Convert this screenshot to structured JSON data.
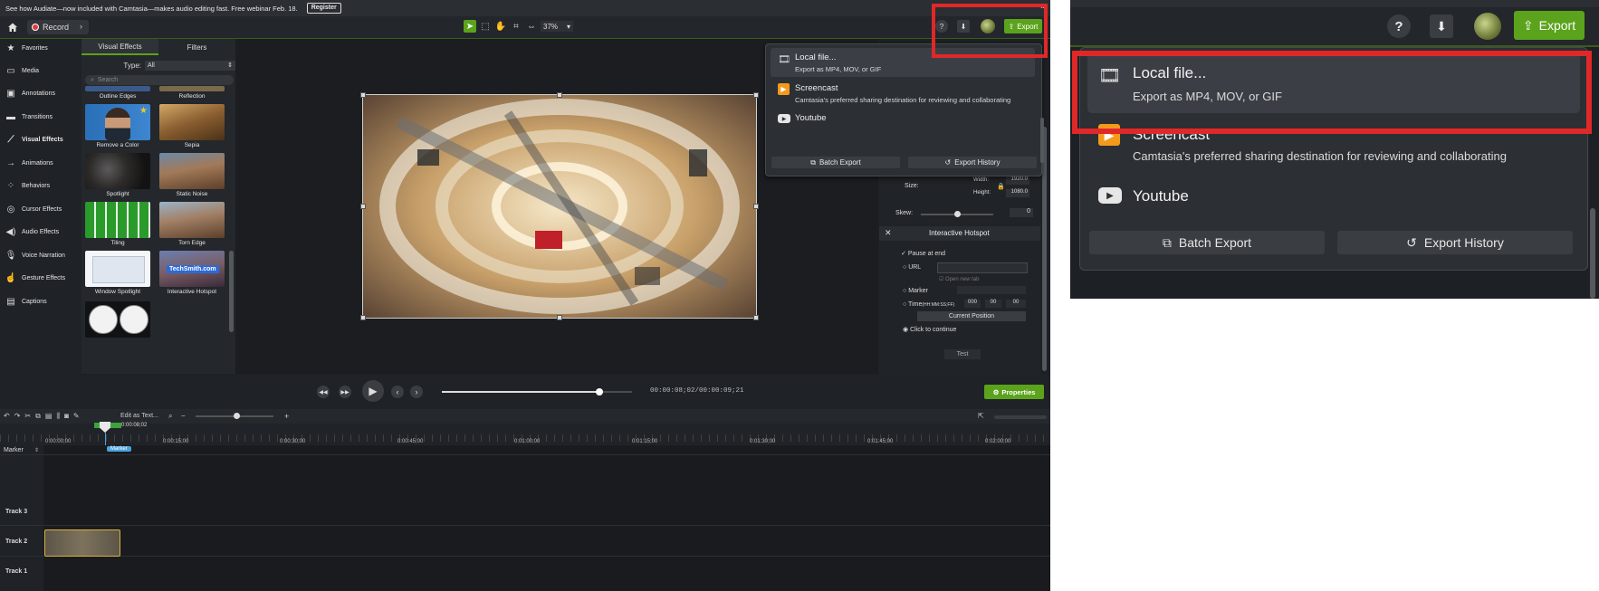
{
  "banner": {
    "text": "See how Audiate—now included with Camtasia—makes audio editing fast. Free webinar Feb. 18.",
    "register": "Register"
  },
  "topbar": {
    "record": "Record",
    "zoom": "37%",
    "export": "Export"
  },
  "sidebar": {
    "items": [
      {
        "label": "Favorites",
        "icon": "star-icon"
      },
      {
        "label": "Media",
        "icon": "media-icon"
      },
      {
        "label": "Annotations",
        "icon": "annotation-icon"
      },
      {
        "label": "Transitions",
        "icon": "transition-icon"
      },
      {
        "label": "Visual Effects",
        "icon": "wand-icon"
      },
      {
        "label": "Animations",
        "icon": "animation-icon"
      },
      {
        "label": "Behaviors",
        "icon": "behavior-icon"
      },
      {
        "label": "Cursor Effects",
        "icon": "cursor-icon"
      },
      {
        "label": "Audio Effects",
        "icon": "speaker-icon"
      },
      {
        "label": "Voice Narration",
        "icon": "mic-icon"
      },
      {
        "label": "Gesture Effects",
        "icon": "hand-icon"
      },
      {
        "label": "Captions",
        "icon": "cc-icon"
      }
    ]
  },
  "library": {
    "tabs": [
      "Visual Effects",
      "Filters"
    ],
    "type_label": "Type:",
    "type_value": "All",
    "search_placeholder": "Search",
    "items": [
      "Outline Edges",
      "Reflection",
      "Remove a Color",
      "Sepia",
      "Spotlight",
      "Static Noise",
      "Tiling",
      "Torn Edge",
      "Window Spotlight",
      "Interactive Hotspot"
    ],
    "hotspot_text": "TechSmith.com"
  },
  "export_menu": {
    "local_title": "Local file...",
    "local_sub": "Export as MP4, MOV, or GIF",
    "screencast_title": "Screencast",
    "screencast_sub": "Camtasia's preferred sharing destination for reviewing and collaborating",
    "youtube": "Youtube",
    "batch": "Batch Export",
    "history": "Export History"
  },
  "properties": {
    "size_label": "Size:",
    "width_label": "Width:",
    "width": "1920.0",
    "height_label": "Height:",
    "height": "1080.0",
    "skew_label": "Skew:",
    "skew": "0",
    "section": "Interactive Hotspot",
    "pause": "Pause at end",
    "url": "URL",
    "open_new_tab": "Open new tab",
    "marker": "Marker",
    "time": "Time",
    "time_fmt": "(HH:MM:SS;FF)",
    "time_h": "000",
    "time_m": "00",
    "time_s": "00",
    "current_position": "Current Position",
    "click_continue": "Click to continue",
    "test": "Test",
    "properties_btn": "Properties"
  },
  "playback": {
    "timecode_cur": "00:00:08;02",
    "timecode_total": "00:00:09;21",
    "progress": 0.83
  },
  "timeline": {
    "edit_as_text": "Edit as Text...",
    "playhead": "0:00:08;02",
    "ruler": [
      "0:00:00;00",
      "0:00:15;00",
      "0:00:30;00",
      "0:00:45;00",
      "0:01:00;00",
      "0:01:15;00",
      "0:01:30;00",
      "0:01:45;00",
      "0:02:00;00"
    ],
    "marker_label": "Marker",
    "marker_flag": "Marker",
    "tracks": [
      "Track 3",
      "Track 2",
      "Track 1"
    ]
  }
}
